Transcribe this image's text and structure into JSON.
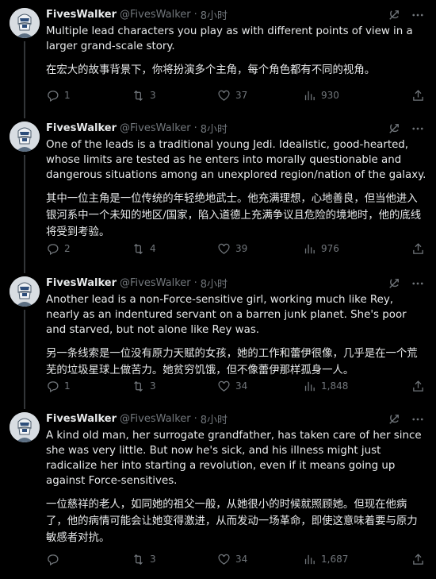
{
  "tweets": [
    {
      "name": "FivesWalker",
      "handle": "@FivesWalker",
      "dot": "·",
      "time": "8小时",
      "text_en": "Multiple lead characters you play as with different points of view in a larger grand-scale story.",
      "text_zh": "在宏大的故事背景下，你将扮演多个主角，每个角色都有不同的视角。",
      "replies": "1",
      "retweets": "3",
      "likes": "37",
      "views": "930"
    },
    {
      "name": "FivesWalker",
      "handle": "@FivesWalker",
      "dot": "·",
      "time": "8小时",
      "text_en": "One of the leads is a traditional young Jedi. Idealistic, good-hearted, whose limits are tested as he enters into morally questionable and dangerous situations among an unexplored region/nation of the galaxy.",
      "text_zh": "其中一位主角是一位传统的年轻绝地武士。他充满理想，心地善良，但当他进入银河系中一个未知的地区/国家，陷入道德上充满争议且危险的境地时，他的底线将受到考验。",
      "replies": "2",
      "retweets": "4",
      "likes": "39",
      "views": "976"
    },
    {
      "name": "FivesWalker",
      "handle": "@FivesWalker",
      "dot": "·",
      "time": "8小时",
      "text_en": "Another lead is a non-Force-sensitive girl, working much like Rey, nearly as an indentured servant on a barren junk planet. She's poor and starved, but not alone like Rey was.",
      "text_zh": "另一条线索是一位没有原力天赋的女孩，她的工作和蕾伊很像，几乎是在一个荒芜的垃圾星球上做苦力。她贫穷饥饿，但不像蕾伊那样孤身一人。",
      "replies": "1",
      "retweets": "3",
      "likes": "34",
      "views": "1,848"
    },
    {
      "name": "FivesWalker",
      "handle": "@FivesWalker",
      "dot": "·",
      "time": "8小时",
      "text_en": "A kind old man, her surrogate grandfather, has taken care of her since she was very little. But now he's sick, and his illness might just radicalize her into starting a revolution, even if it means going up against Force-sensitives.",
      "text_zh": "一位慈祥的老人，如同她的祖父一般，从她很小的时候就照顾她。但现在他病了，他的病情可能会让她变得激进，从而发动一场革命，即使这意味着要与原力敏感者对抗。",
      "replies": "",
      "retweets": "3",
      "likes": "34",
      "views": "1,687"
    }
  ],
  "icons": {
    "grok": "grok-icon",
    "more": "more-icon",
    "reply": "reply-icon",
    "retweet": "retweet-icon",
    "like": "like-icon",
    "views": "views-icon",
    "share": "share-icon"
  },
  "colors": {
    "background": "#000000",
    "text": "#e7e9ea",
    "muted": "#71767b",
    "thread_line": "#333639"
  }
}
